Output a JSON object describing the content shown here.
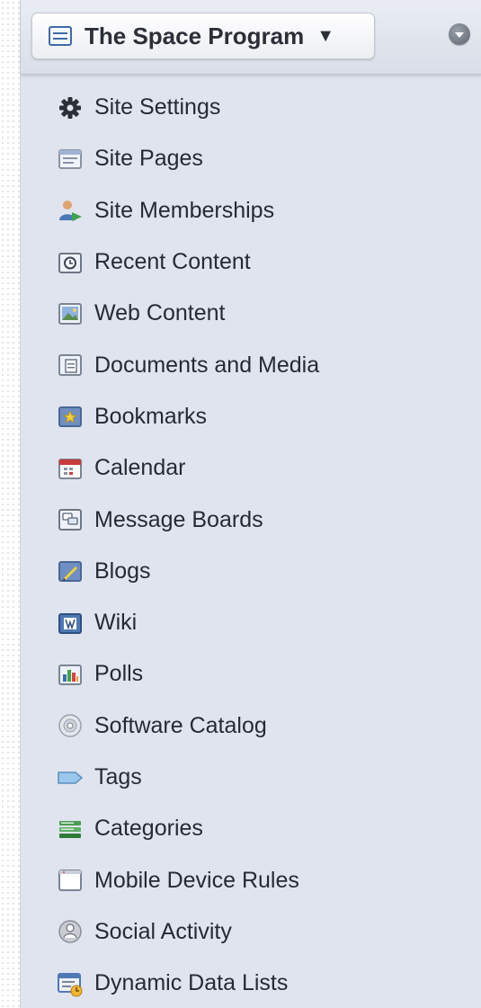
{
  "header": {
    "site_name": "The Space Program",
    "caret": "▼"
  },
  "menu": {
    "items": [
      {
        "label": "Site Settings",
        "icon": "gear-icon"
      },
      {
        "label": "Site Pages",
        "icon": "pages-icon"
      },
      {
        "label": "Site Memberships",
        "icon": "users-icon"
      },
      {
        "label": "Recent Content",
        "icon": "clock-icon"
      },
      {
        "label": "Web Content",
        "icon": "web-content-icon"
      },
      {
        "label": "Documents and Media",
        "icon": "documents-icon"
      },
      {
        "label": "Bookmarks",
        "icon": "star-icon"
      },
      {
        "label": "Calendar",
        "icon": "calendar-icon"
      },
      {
        "label": "Message Boards",
        "icon": "message-boards-icon"
      },
      {
        "label": "Blogs",
        "icon": "blogs-icon"
      },
      {
        "label": "Wiki",
        "icon": "wiki-icon"
      },
      {
        "label": "Polls",
        "icon": "polls-icon"
      },
      {
        "label": "Software Catalog",
        "icon": "disc-icon"
      },
      {
        "label": "Tags",
        "icon": "tag-icon"
      },
      {
        "label": "Categories",
        "icon": "categories-icon"
      },
      {
        "label": "Mobile Device Rules",
        "icon": "mobile-device-icon"
      },
      {
        "label": "Social Activity",
        "icon": "social-activity-icon"
      },
      {
        "label": "Dynamic Data Lists",
        "icon": "dynamic-data-lists-icon"
      }
    ]
  },
  "colors": {
    "panel_bg": "#dfe4ee",
    "text": "#262b33"
  }
}
